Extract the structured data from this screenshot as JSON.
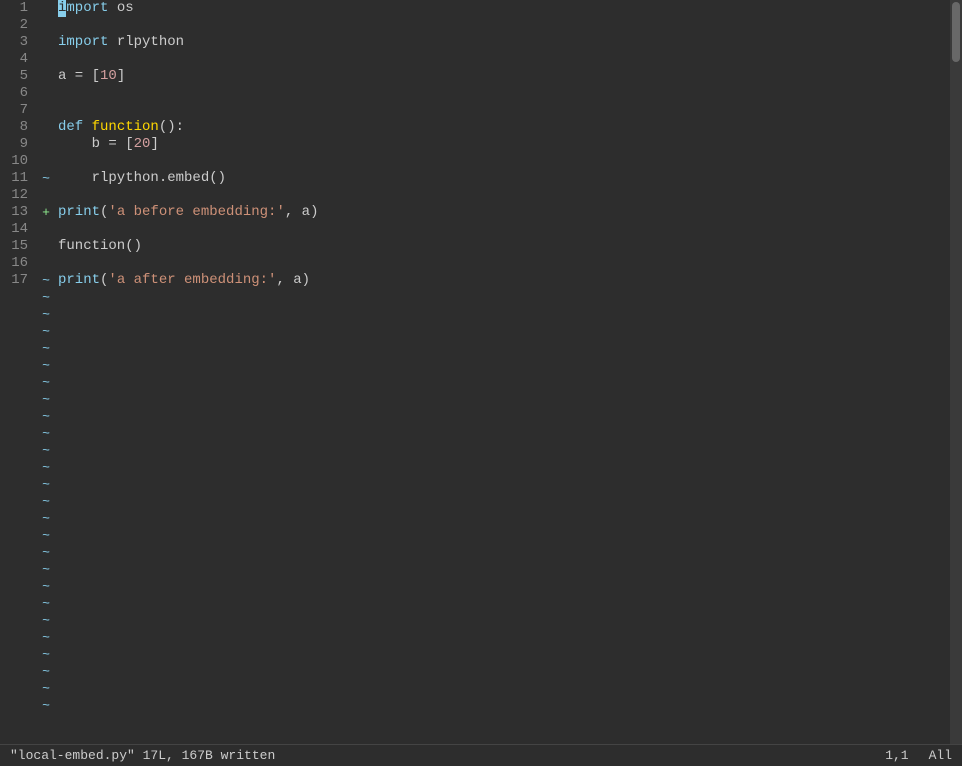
{
  "editor": {
    "lines": [
      {
        "num": 1,
        "marker": "",
        "tokens": [
          {
            "t": "cursor",
            "text": "i"
          },
          {
            "t": "kw",
            "text": "mport"
          },
          {
            "t": "plain",
            "text": " os"
          }
        ]
      },
      {
        "num": 2,
        "marker": "",
        "tokens": []
      },
      {
        "num": 3,
        "marker": "",
        "tokens": [
          {
            "t": "kw",
            "text": "import"
          },
          {
            "t": "plain",
            "text": " rlpython"
          }
        ]
      },
      {
        "num": 4,
        "marker": "",
        "tokens": []
      },
      {
        "num": 5,
        "marker": "",
        "tokens": [
          {
            "t": "plain",
            "text": "a = ["
          },
          {
            "t": "num",
            "text": "10"
          },
          {
            "t": "plain",
            "text": "]"
          }
        ]
      },
      {
        "num": 6,
        "marker": "",
        "tokens": []
      },
      {
        "num": 7,
        "marker": "",
        "tokens": []
      },
      {
        "num": 8,
        "marker": "",
        "tokens": [
          {
            "t": "kw",
            "text": "def"
          },
          {
            "t": "plain",
            "text": " "
          },
          {
            "t": "func",
            "text": "function"
          },
          {
            "t": "plain",
            "text": "():"
          }
        ]
      },
      {
        "num": 9,
        "marker": "",
        "tokens": [
          {
            "t": "plain",
            "text": "    b = ["
          },
          {
            "t": "num",
            "text": "20"
          },
          {
            "t": "plain",
            "text": "]"
          }
        ]
      },
      {
        "num": 10,
        "marker": "",
        "tokens": []
      },
      {
        "num": 11,
        "marker": "~",
        "tokens": [
          {
            "t": "plain",
            "text": "    rlpython.embed()"
          }
        ]
      },
      {
        "num": 12,
        "marker": "",
        "tokens": []
      },
      {
        "num": 13,
        "marker": "+",
        "tokens": [
          {
            "t": "kw",
            "text": "print"
          },
          {
            "t": "plain",
            "text": "("
          },
          {
            "t": "str",
            "text": "'a before embedding:'"
          },
          {
            "t": "plain",
            "text": ", a)"
          }
        ]
      },
      {
        "num": 14,
        "marker": "",
        "tokens": []
      },
      {
        "num": 15,
        "marker": "",
        "tokens": [
          {
            "t": "plain",
            "text": "function()"
          }
        ]
      },
      {
        "num": 16,
        "marker": "",
        "tokens": []
      },
      {
        "num": 17,
        "marker": "~",
        "tokens": [
          {
            "t": "kw",
            "text": "print"
          },
          {
            "t": "plain",
            "text": "("
          },
          {
            "t": "str",
            "text": "'a after embedding:'"
          },
          {
            "t": "plain",
            "text": ", a)"
          }
        ]
      }
    ],
    "tildes": [
      18,
      19,
      20,
      21,
      22,
      23,
      24,
      25,
      26,
      27,
      28,
      29,
      30,
      31,
      32,
      33,
      34,
      35,
      36,
      37,
      38,
      39,
      40,
      41,
      42
    ],
    "status": {
      "left": "\"local-embed.py\" 17L, 167B written",
      "pos": "1,1",
      "mode": "All"
    }
  }
}
